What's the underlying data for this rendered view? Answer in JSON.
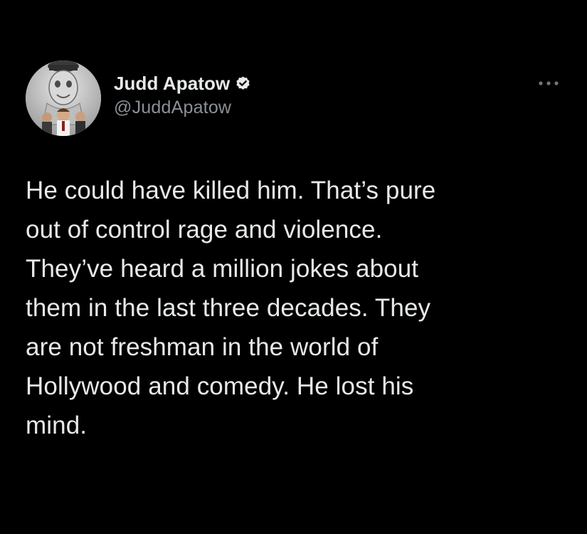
{
  "author": {
    "display_name": "Judd Apatow",
    "handle": "@JuddApatow",
    "verified": true
  },
  "tweet": {
    "text": "He could have killed him.  That’s pure\nout of control rage and violence.\nThey’ve heard a million jokes about\nthem in the last three decades.  They\nare not freshman in the world of\nHollywood and comedy.  He lost his\nmind."
  },
  "icons": {
    "verified": "verified-badge-icon",
    "more": "more-options-icon"
  },
  "colors": {
    "background": "#000000",
    "primary_text": "#e7e9ea",
    "secondary_text": "#8b9096"
  }
}
